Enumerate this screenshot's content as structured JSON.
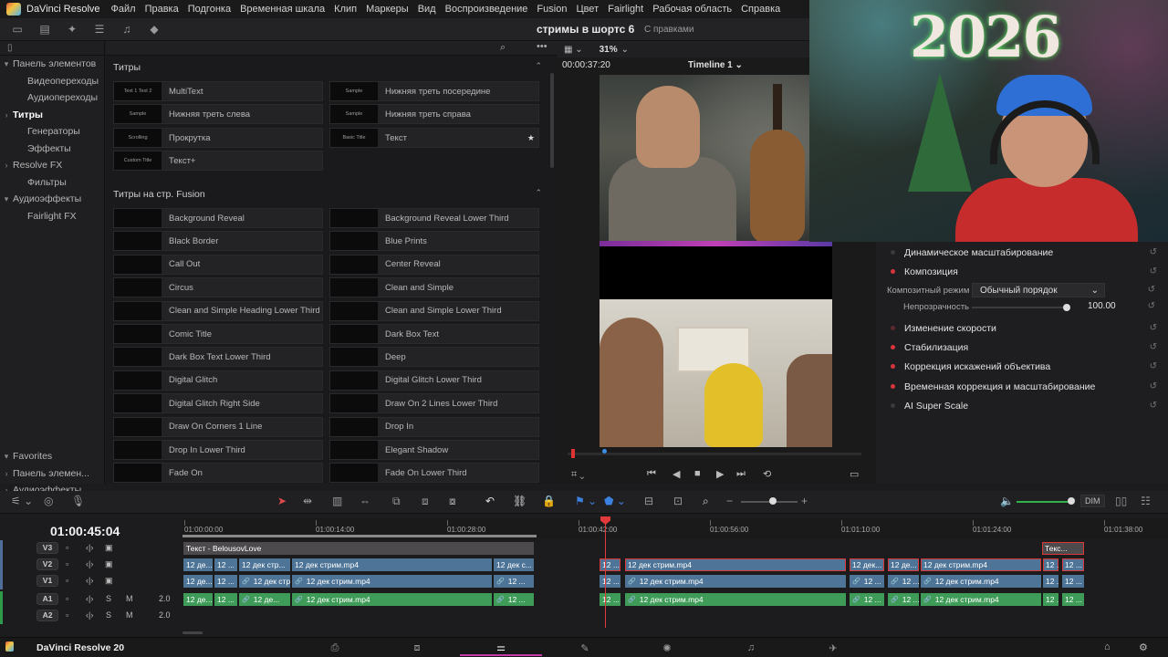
{
  "menubar": {
    "app": "DaVinci Resolve",
    "items": [
      "Файл",
      "Правка",
      "Подгонка",
      "Временная шкала",
      "Клип",
      "Маркеры",
      "Вид",
      "Воспроизведение",
      "Fusion",
      "Цвет",
      "Fairlight",
      "Рабочая область",
      "Справка"
    ]
  },
  "toolbar": {
    "project": "стримы в шортс 6",
    "status": "С правками",
    "zoom": "31%"
  },
  "left_panel": {
    "items": [
      {
        "label": "Панель элементов",
        "arrow": "▾"
      },
      {
        "label": "Видеопереходы",
        "arrow": ""
      },
      {
        "label": "Аудиопереходы",
        "arrow": ""
      },
      {
        "label": "Титры",
        "arrow": "›"
      },
      {
        "label": "Генераторы",
        "arrow": ""
      },
      {
        "label": "Эффекты",
        "arrow": ""
      },
      {
        "label": "Resolve FX",
        "arrow": "›"
      },
      {
        "label": "Фильтры",
        "arrow": ""
      },
      {
        "label": "Аудиоэффекты",
        "arrow": "▾"
      },
      {
        "label": "Fairlight FX",
        "arrow": ""
      }
    ],
    "favorites": [
      {
        "label": "Favorites",
        "arrow": "▾"
      },
      {
        "label": "Панель элемен...",
        "arrow": "›"
      },
      {
        "label": "Аудиоэффекты",
        "arrow": "›"
      }
    ]
  },
  "titles": {
    "section1": "Титры",
    "section2": "Титры на стр. Fusion",
    "basic": [
      {
        "label": "MultiText",
        "thumb": "Text 1 Text 2"
      },
      {
        "label": "Нижняя треть посередине",
        "thumb": "Sample"
      },
      {
        "label": "Нижняя треть слева",
        "thumb": "Sample"
      },
      {
        "label": "Нижняя треть справа",
        "thumb": "Sample"
      },
      {
        "label": "Прокрутка",
        "thumb": "Scrolling"
      },
      {
        "label": "Текст",
        "thumb": "Basic Title"
      },
      {
        "label": "Текст+",
        "thumb": "Custom Title"
      }
    ],
    "fusion": [
      "Background Reveal",
      "Background Reveal Lower Third",
      "Black Border",
      "Blue Prints",
      "Call Out",
      "Center Reveal",
      "Circus",
      "Clean and Simple",
      "Clean and Simple Heading Lower Third",
      "Clean and Simple Lower Third",
      "Comic Title",
      "Dark Box Text",
      "Dark Box Text Lower Third",
      "Deep",
      "Digital Glitch",
      "Digital Glitch Lower Third",
      "Digital Glitch Right Side",
      "Draw On 2 Lines Lower Third",
      "Draw On Corners 1 Line",
      "Drop In",
      "Drop In Lower Third",
      "Elegant Shadow",
      "Fade On",
      "Fade On Lower Third"
    ]
  },
  "viewer": {
    "timecode": "00:00:37:20",
    "timeline_name": "Timeline 1"
  },
  "webcam": {
    "year": "2026"
  },
  "inspector": {
    "rows": [
      {
        "label": "Динамическое масштабирование",
        "on": false
      },
      {
        "label": "Композиция",
        "on": true
      },
      {
        "label": "Изменение скорости",
        "on": false
      },
      {
        "label": "Стабилизация",
        "on": true
      },
      {
        "label": "Коррекция искажений объектива",
        "on": true
      },
      {
        "label": "Временная коррекция и масштабирование",
        "on": true
      },
      {
        "label": "AI Super Scale",
        "on": false
      }
    ],
    "composite_mode_label": "Композитный режим",
    "composite_mode_value": "Обычный порядок",
    "opacity_label": "Непрозрачность",
    "opacity_value": "100.00"
  },
  "timeline": {
    "timecode": "01:00:45:04",
    "ruler": [
      "01:00:00:00",
      "01:00:14:00",
      "01:00:28:00",
      "01:00:42:00",
      "01:00:56:00",
      "01:01:10:00",
      "01:01:24:00",
      "01:01:38:00"
    ],
    "tracks": [
      "V3",
      "V2",
      "V1",
      "A1",
      "A2"
    ],
    "audio_level": "2.0",
    "dim": "DIM",
    "clip_v3": "Текст - BelousovLove",
    "clip_v3b": "Текс...",
    "clip_name": "12 дек стрим.mp4",
    "clip_short": "12 де...",
    "clip_short2": "12 ...",
    "clip_mid": "12 дек стр...",
    "clip_mid2": "12 дек с...",
    "clip_mid3": "12 дек...",
    "clip_mid4": "12 де..."
  },
  "taskbar": {
    "brand": "DaVinci Resolve 20"
  }
}
